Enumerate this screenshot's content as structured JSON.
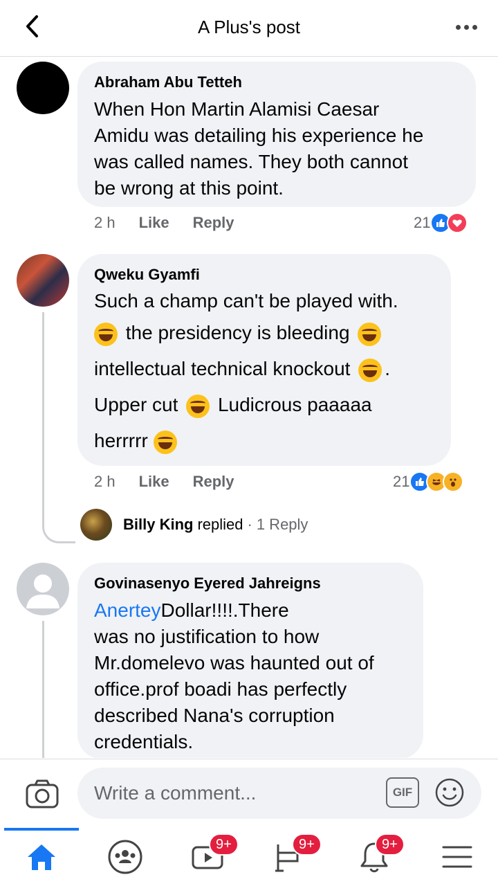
{
  "header": {
    "title": "A Plus's post"
  },
  "comments": [
    {
      "author": "Abraham Abu Tetteh",
      "lines": [
        "When Hon Martin Alamisi Caesar",
        "Amidu was detailing his experience he",
        "was called names. They both cannot",
        "be wrong at this point."
      ],
      "time": "2 h",
      "like_label": "Like",
      "reply_label": "Reply",
      "reaction_count": "21"
    },
    {
      "author": "Qweku Gyamfi",
      "line1": "Such a champ can't be played with.",
      "line2": "the presidency is bleeding",
      "line3": "intellectual technical knockout",
      "line3_end": ".",
      "line4a": "Upper cut",
      "line4b": "Ludicrous paaaaa",
      "line5": "herrrrr",
      "time": "2 h",
      "like_label": "Like",
      "reply_label": "Reply",
      "reaction_count": "21",
      "reply_preview": {
        "name": "Billy King",
        "verb": "replied",
        "separator": "·",
        "count_label": "1 Reply"
      }
    },
    {
      "author": "Govinasenyo Eyered Jahreigns",
      "mention": "Anertey",
      "first_line_rest": "Dollar!!!!.There",
      "lines": [
        "was no justification to how",
        "Mr.domelevo was haunted out of",
        "office.prof boadi has perfectly",
        "described Nana's corruption",
        "credentials."
      ]
    }
  ],
  "composer": {
    "placeholder": "Write a comment...",
    "gif_label": "GIF"
  },
  "nav": {
    "watch_badge": "9+",
    "marketplace_badge": "9+",
    "notifications_badge": "9+"
  },
  "colors": {
    "accent": "#1877f2",
    "badge": "#e41e3f",
    "bubble": "#f0f2f5"
  }
}
